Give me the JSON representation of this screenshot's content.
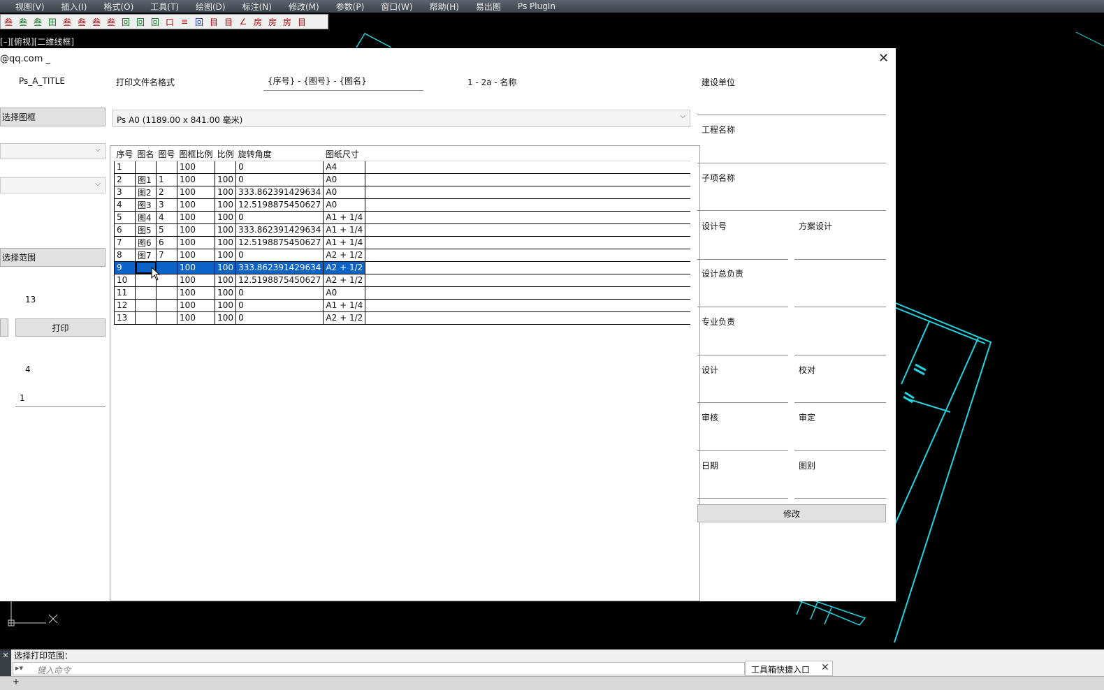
{
  "menu": [
    "视图(V)",
    "插入(I)",
    "格式(O)",
    "工具(T)",
    "绘图(D)",
    "标注(N)",
    "修改(M)",
    "参数(P)",
    "窗口(W)",
    "帮助(H)",
    "易出图",
    "Ps PlugIn"
  ],
  "toolbar_icons": [
    "叁",
    "叁",
    "叁",
    "田",
    "叁",
    "叁",
    "叁",
    "叁",
    "回",
    "回",
    "回",
    "口",
    "≡",
    "回",
    "目",
    "目",
    "∠",
    "房",
    "房",
    "房",
    "目"
  ],
  "viewport_label": "[–][俯视][二维线框]",
  "dialog": {
    "title": "@qq.com _",
    "title_block_name": "Ps_A_TITLE",
    "filename_format_label": "打印文件名格式",
    "filename_format_value": "{序号} - {图号} - {图名}",
    "filename_preview": "1 - 2a - 名称",
    "select_frame_button": "选择图框",
    "paper_size_selected": "Ps A0 (1189.00 x 841.00 毫米)",
    "select_range_button": "选择范围",
    "count_value": "13",
    "print_button": "打印",
    "copies_value": "4",
    "start_value": "1",
    "columns": [
      "序号",
      "图名",
      "图号",
      "图框比例",
      "比例",
      "旋转角度",
      "图纸尺寸"
    ],
    "rows": [
      [
        "1",
        "",
        "",
        "100",
        "",
        "0",
        "A4"
      ],
      [
        "2",
        "图1",
        "1",
        "100",
        "100",
        "0",
        "A0"
      ],
      [
        "3",
        "图2",
        "2",
        "100",
        "100",
        "333.862391429634",
        "A0"
      ],
      [
        "4",
        "图3",
        "3",
        "100",
        "100",
        "12.5198875450627",
        "A0"
      ],
      [
        "5",
        "图4",
        "4",
        "100",
        "100",
        "0",
        "A1 + 1/4"
      ],
      [
        "6",
        "图5",
        "5",
        "100",
        "100",
        "333.862391429634",
        "A1 + 1/4"
      ],
      [
        "7",
        "图6",
        "6",
        "100",
        "100",
        "12.5198875450627",
        "A1 + 1/4"
      ],
      [
        "8",
        "图7",
        "7",
        "100",
        "100",
        "0",
        "A2 + 1/2"
      ],
      [
        "9",
        "",
        "",
        "100",
        "100",
        "333.862391429634",
        "A2 + 1/2"
      ],
      [
        "10",
        "",
        "",
        "100",
        "100",
        "12.5198875450627",
        "A2 + 1/2"
      ],
      [
        "11",
        "",
        "",
        "100",
        "100",
        "0",
        "A0"
      ],
      [
        "12",
        "",
        "",
        "100",
        "100",
        "0",
        "A1 + 1/4"
      ],
      [
        "13",
        "",
        "",
        "100",
        "100",
        "0",
        "A2 + 1/2"
      ]
    ],
    "selected_row": 9,
    "right_panel": {
      "build_unit": "建设单位",
      "project_name": "工程名称",
      "sub_item": "子项名称",
      "design_no": "设计号",
      "design_no_value": "方案设计",
      "chief_designer": "设计总负责",
      "discipline_lead": "专业负责",
      "designer": "设计",
      "checker": "校对",
      "reviewer": "审核",
      "approver": "审定",
      "date": "日期",
      "drawing_type": "图别",
      "modify_button": "修改"
    }
  },
  "command": {
    "history": "选择打印范围：",
    "placeholder": "键入命令"
  },
  "toolbox_entry": "工具箱快捷入口",
  "colors": {
    "menubar": "#4a5059",
    "selection": "#0a64c8",
    "cad_lines": "#22d3e0",
    "cad_background": "#000000"
  }
}
